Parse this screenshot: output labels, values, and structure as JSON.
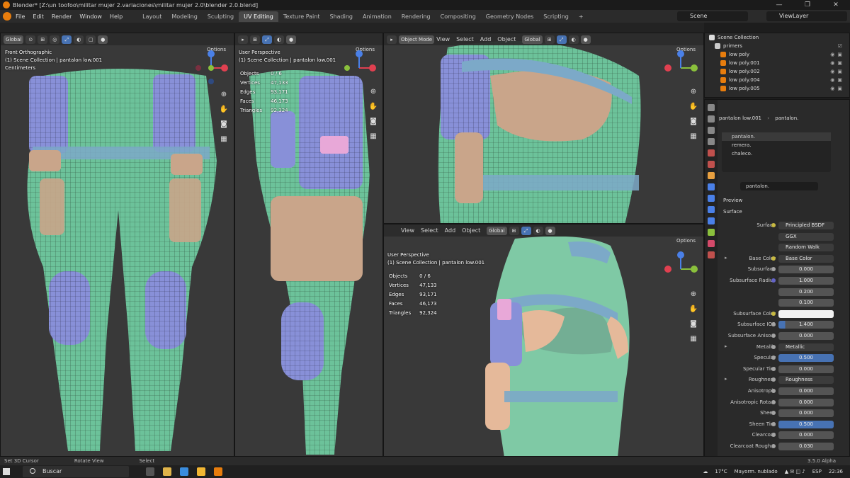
{
  "window": {
    "title": "Blender* [Z:\\un toofoo\\militar mujer 2.variaciones\\militar mujer 2.0\\blender 2.0.blend]"
  },
  "menu": [
    "File",
    "Edit",
    "Render",
    "Window",
    "Help"
  ],
  "workspaces": [
    "Layout",
    "Modeling",
    "Sculpting",
    "UV Editing",
    "Texture Paint",
    "Shading",
    "Animation",
    "Rendering",
    "Compositing",
    "Geometry Nodes",
    "Scripting"
  ],
  "active_workspace": "UV Editing",
  "scene": "Scene",
  "viewlayer": "ViewLayer",
  "viewports": {
    "v1": {
      "transform": "Global",
      "options": "Options",
      "view": "Front Orthographic",
      "collection": "(1) Scene Collection | pantalon low.001",
      "units": "Centimeters"
    },
    "v2": {
      "options": "Options",
      "view": "User Perspective",
      "collection": "(1) Scene Collection | pantalon low.001",
      "stats": {
        "objects_label": "Objects",
        "objects": "0 / 6",
        "vertices_label": "Vertices",
        "vertices": "47,133",
        "edges_label": "Edges",
        "edges": "93,171",
        "faces_label": "Faces",
        "faces": "46,173",
        "triangles_label": "Triangles",
        "triangles": "92,324"
      }
    },
    "v3": {
      "mode": "Object Mode",
      "menus": [
        "View",
        "Select",
        "Add",
        "Object"
      ],
      "transform": "Global",
      "options": "Options"
    },
    "v4": {
      "menus": [
        "View",
        "Select",
        "Add",
        "Object"
      ],
      "transform": "Global",
      "options": "Options",
      "view": "User Perspective",
      "collection": "(1) Scene Collection | pantalon low.001",
      "stats": {
        "objects_label": "Objects",
        "objects": "0 / 6",
        "vertices_label": "Vertices",
        "vertices": "47,133",
        "edges_label": "Edges",
        "edges": "93,171",
        "faces_label": "Faces",
        "faces": "46,173",
        "triangles_label": "Triangles",
        "triangles": "92,324"
      }
    }
  },
  "outliner": {
    "root": "Scene Collection",
    "items": [
      "primers",
      "low poly",
      "low poly.001",
      "low poly.002",
      "low poly.004",
      "low poly.005"
    ]
  },
  "properties": {
    "breadcrumb_obj": "pantalon low.001",
    "breadcrumb_mat": "pantalon.",
    "slots": [
      "pantalon.",
      "remera.",
      "chaleco."
    ],
    "material": "pantalon.",
    "preview": "Preview",
    "surface_section": "Surface",
    "rows": [
      {
        "label": "Surface",
        "value": "Principled BSDF",
        "type": "dk",
        "dot": "y"
      },
      {
        "label": "",
        "value": "GGX",
        "type": "dk"
      },
      {
        "label": "",
        "value": "Random Walk",
        "type": "dk"
      },
      {
        "label": "Base Color",
        "value": "Base Color",
        "type": "dk",
        "dot": "y",
        "arrow": true
      },
      {
        "label": "Subsurface",
        "value": "0.000",
        "type": "",
        "dot": "g"
      },
      {
        "label": "Subsurface Radius",
        "value": "1.000",
        "type": "",
        "dot": "p"
      },
      {
        "label": "",
        "value": "0.200",
        "type": ""
      },
      {
        "label": "",
        "value": "0.100",
        "type": ""
      },
      {
        "label": "Subsurface Color",
        "value": "",
        "type": "white",
        "dot": "y"
      },
      {
        "label": "Subsurface IOR",
        "value": "1.400",
        "type": "part",
        "dot": "g"
      },
      {
        "label": "Subsurface Aniso...",
        "value": "0.000",
        "type": "",
        "dot": "g"
      },
      {
        "label": "Metallic",
        "value": "Metallic",
        "type": "dk",
        "dot": "g",
        "arrow": true
      },
      {
        "label": "Specular",
        "value": "0.500",
        "type": "bl",
        "dot": "g"
      },
      {
        "label": "Specular Tint",
        "value": "0.000",
        "type": "",
        "dot": "g"
      },
      {
        "label": "Roughness",
        "value": "Roughness",
        "type": "dk",
        "dot": "g",
        "arrow": true
      },
      {
        "label": "Anisotropic",
        "value": "0.000",
        "type": "",
        "dot": "g"
      },
      {
        "label": "Anisotropic Rota...",
        "value": "0.000",
        "type": "",
        "dot": "g"
      },
      {
        "label": "Sheen",
        "value": "0.000",
        "type": "",
        "dot": "g"
      },
      {
        "label": "Sheen Tint",
        "value": "0.500",
        "type": "bl",
        "dot": "g"
      },
      {
        "label": "Clearcoat",
        "value": "0.000",
        "type": "",
        "dot": "g"
      },
      {
        "label": "Clearcoat Rough...",
        "value": "0.030",
        "type": "",
        "dot": "g"
      }
    ]
  },
  "status": {
    "left": "Set 3D Cursor",
    "mid": "Rotate View",
    "right": "Select",
    "version": "3.5.0 Alpha"
  },
  "taskbar": {
    "search": "Buscar",
    "temp": "17°C",
    "weather": "Mayorm. nublado",
    "lang": "ESP",
    "time": "22:36"
  }
}
